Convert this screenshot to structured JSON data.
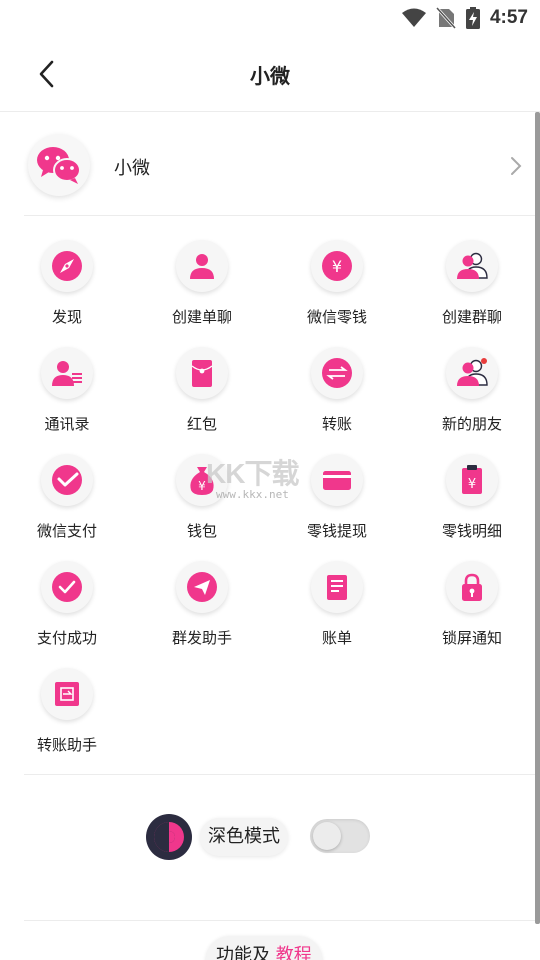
{
  "status": {
    "time": "4:57"
  },
  "header": {
    "title": "小微"
  },
  "profile": {
    "name": "小微"
  },
  "colors": {
    "accent": "#f0378c",
    "dark": "#2c2c40"
  },
  "grid": [
    {
      "label": "发现",
      "icon": "compass-icon",
      "name": "grid-item-discover"
    },
    {
      "label": "创建单聊",
      "icon": "person-icon",
      "name": "grid-item-create-single-chat"
    },
    {
      "label": "微信零钱",
      "icon": "yuan-coin-icon",
      "name": "grid-item-wechat-change"
    },
    {
      "label": "创建群聊",
      "icon": "group-icon",
      "name": "grid-item-create-group-chat"
    },
    {
      "label": "通讯录",
      "icon": "contacts-icon",
      "name": "grid-item-contacts"
    },
    {
      "label": "红包",
      "icon": "red-envelope-icon",
      "name": "grid-item-red-packet"
    },
    {
      "label": "转账",
      "icon": "transfer-icon",
      "name": "grid-item-transfer"
    },
    {
      "label": "新的朋友",
      "icon": "new-friend-icon",
      "name": "grid-item-new-friends"
    },
    {
      "label": "微信支付",
      "icon": "wechat-pay-icon",
      "name": "grid-item-wechat-pay"
    },
    {
      "label": "钱包",
      "icon": "money-bag-icon",
      "name": "grid-item-wallet"
    },
    {
      "label": "零钱提现",
      "icon": "card-icon",
      "name": "grid-item-withdraw"
    },
    {
      "label": "零钱明细",
      "icon": "receipt-yuan-icon",
      "name": "grid-item-change-details"
    },
    {
      "label": "支付成功",
      "icon": "check-circle-icon",
      "name": "grid-item-pay-success"
    },
    {
      "label": "群发助手",
      "icon": "send-icon",
      "name": "grid-item-broadcast-assistant"
    },
    {
      "label": "账单",
      "icon": "bill-icon",
      "name": "grid-item-bill"
    },
    {
      "label": "锁屏通知",
      "icon": "lock-icon",
      "name": "grid-item-lockscreen-notify"
    },
    {
      "label": "转账助手",
      "icon": "transfer-assistant-icon",
      "name": "grid-item-transfer-assistant"
    }
  ],
  "dark_mode": {
    "label": "深色模式",
    "enabled": false
  },
  "footer": {
    "text": "功能及",
    "accent_text": "教程"
  },
  "watermark": {
    "main": "KK下载",
    "url": "www.kkx.net"
  }
}
